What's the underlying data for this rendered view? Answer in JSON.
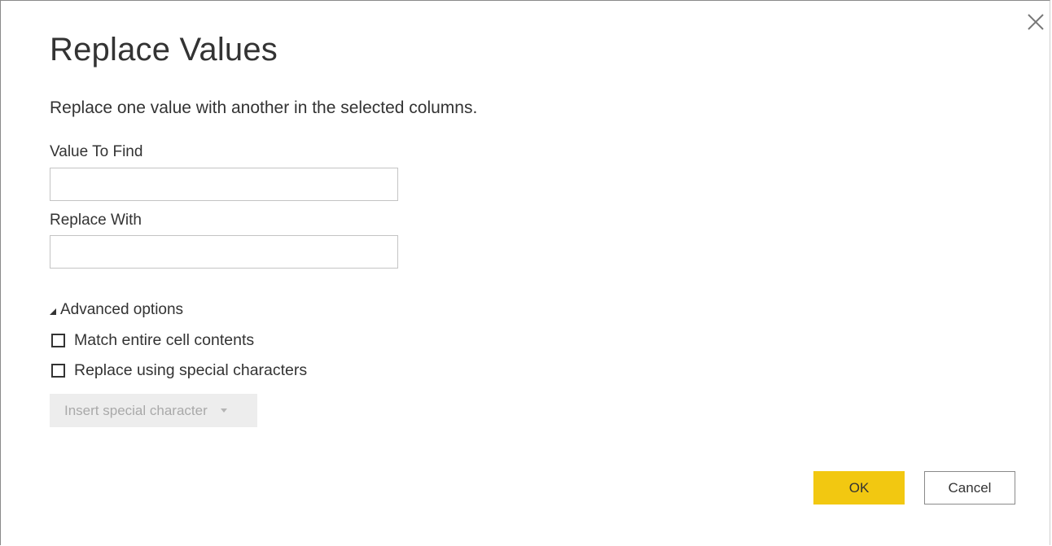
{
  "dialog": {
    "title": "Replace Values",
    "description": "Replace one value with another in the selected columns.",
    "close_icon": "close-icon"
  },
  "fields": {
    "value_to_find": {
      "label": "Value To Find",
      "value": ""
    },
    "replace_with": {
      "label": "Replace With",
      "value": ""
    }
  },
  "advanced": {
    "label": "Advanced options",
    "expanded": true,
    "icon": "triangle-expanded-icon",
    "options": [
      {
        "label": "Match entire cell contents",
        "checked": false
      },
      {
        "label": "Replace using special characters",
        "checked": false
      }
    ],
    "insert_special": {
      "label": "Insert special character",
      "enabled": false,
      "icon": "chevron-down-icon"
    }
  },
  "buttons": {
    "ok": "OK",
    "cancel": "Cancel"
  },
  "colors": {
    "primary": "#f2c811",
    "text": "#333333",
    "disabled_bg": "#ededed",
    "disabled_text": "#a9a9a9"
  }
}
